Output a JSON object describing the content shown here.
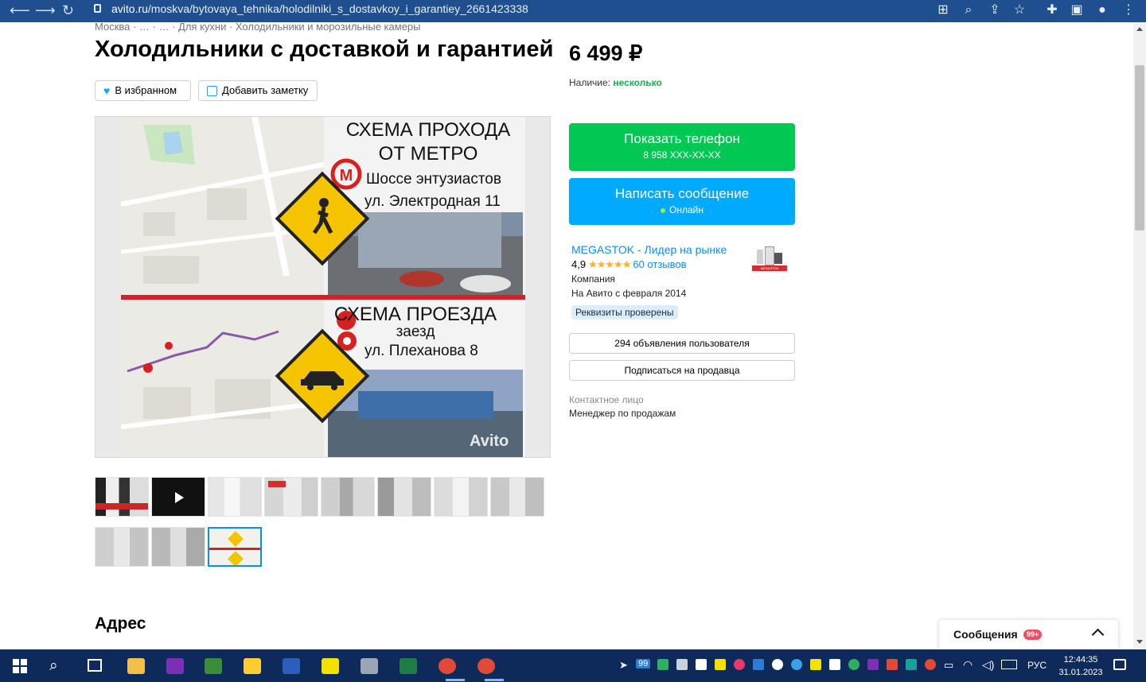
{
  "browser": {
    "url_host": "avito.ru",
    "url_path": "/moskva/bytovaya_tehnika/holodilniki_s_dostavkoy_i_garantiey_2661423338"
  },
  "breadcrumbs": "Москва · … · … · Для кухни · Холодильники и морозильные камеры",
  "title": "Холодильники с доставкой и гарантией",
  "price": "6 499 ₽",
  "availability": {
    "label": "Наличие:",
    "value": "несколько"
  },
  "actions": {
    "favorite": "В избранном",
    "note": "Добавить заметку"
  },
  "image": {
    "top_title_1": "СХЕМА ПРОХОДА",
    "top_title_2": "ОТ МЕТРО",
    "metro_name": "Шоссе энтузиастов",
    "street1": "ул. Электродная 11",
    "bottom_title": "СХЕМА ПРОЕЗДА",
    "entry": "заезд",
    "street2": "ул. Плеханова 8",
    "watermark": "Avito"
  },
  "contact": {
    "phone_label": "Показать телефон",
    "phone_masked": "8 958 XXX-XX-XX",
    "message_label": "Написать сообщение",
    "status": "Онлайн"
  },
  "seller": {
    "name": "MEGASTOK - Лидер на рынке",
    "rating": "4,9",
    "stars": "★★★★★",
    "reviews": "60 отзывов",
    "type": "Компания",
    "since": "На Авито с февраля 2014",
    "verified": "Реквизиты проверены",
    "ads_button": "294 объявления пользователя",
    "subscribe_button": "Подписаться на продавца",
    "contact_label": "Контактное лицо",
    "contact_name": "Менеджер по продажам",
    "logo_text": "MEGASTOK"
  },
  "section_address": "Адрес",
  "messages": {
    "label": "Сообщения",
    "count": "99+"
  },
  "taskbar": {
    "lang": "РУС",
    "time": "12:44:35",
    "date": "31.01.2023",
    "badge": "99"
  },
  "colors": {
    "green": "#00c853",
    "blue": "#00aaff",
    "link": "#0a8ef5",
    "chrome": "#1f4f8f"
  }
}
